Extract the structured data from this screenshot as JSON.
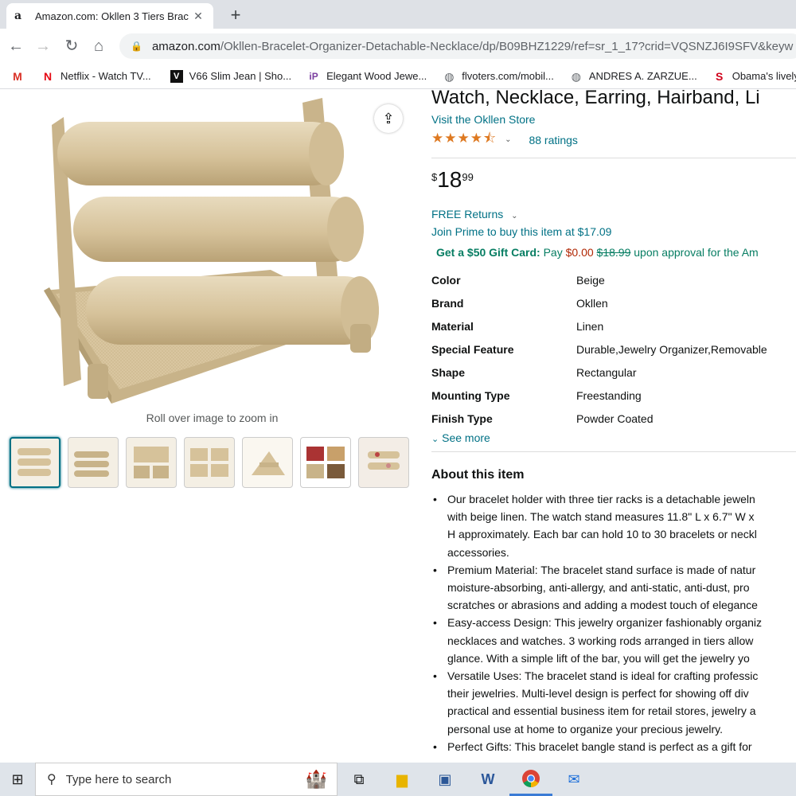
{
  "browser": {
    "tab_favicon": "a",
    "tab_title": "Amazon.com: Okllen 3 Tiers Brac",
    "tab_close": "✕",
    "new_tab": "+",
    "url_host": "amazon.com",
    "url_path": "/Okllen-Bracelet-Organizer-Detachable-Necklace/dp/B09BHZ1229/ref=sr_1_17?crid=VQSNZJ6I9SFV&keyw"
  },
  "bookmarks": [
    {
      "icon": "M",
      "label": ""
    },
    {
      "icon": "N",
      "label": "Netflix - Watch TV..."
    },
    {
      "icon": "V",
      "label": "V66 Slim Jean | Sho..."
    },
    {
      "icon": "iP",
      "label": "Elegant Wood Jewe..."
    },
    {
      "icon": "globe",
      "label": "flvoters.com/mobil..."
    },
    {
      "icon": "globe",
      "label": "ANDRES A. ZARZUE..."
    },
    {
      "icon": "S",
      "label": "Obama's lively l"
    }
  ],
  "gallery": {
    "zoom_hint": "Roll over image to zoom in",
    "share_icon": "share-icon"
  },
  "product": {
    "title": "Watch, Necklace, Earring, Hairband, Li",
    "store": "Visit the Okllen Store",
    "stars": "★★★★⯪",
    "rating_value": 4.5,
    "ratings": "88 ratings",
    "price_symbol": "$",
    "price_whole": "18",
    "price_fraction": "99",
    "returns": "FREE Returns",
    "prime": "Join Prime to buy this item at $17.09",
    "gift_label": "Get a $50 Gift Card:",
    "gift_pay": "Pay",
    "gift_new": "$0.00",
    "gift_old": "$18.99",
    "gift_tail": "upon approval for the Am"
  },
  "specs": [
    {
      "k": "Color",
      "v": "Beige"
    },
    {
      "k": "Brand",
      "v": "Okllen"
    },
    {
      "k": "Material",
      "v": "Linen"
    },
    {
      "k": "Special Feature",
      "v": "Durable,Jewelry Organizer,Removable"
    },
    {
      "k": "Shape",
      "v": "Rectangular"
    },
    {
      "k": "Mounting Type",
      "v": "Freestanding"
    },
    {
      "k": "Finish Type",
      "v": "Powder Coated"
    }
  ],
  "see_more": "See more",
  "about": {
    "heading": "About this item",
    "lines": [
      "Our bracelet holder with three tier racks is a detachable jeweln",
      "with beige linen. The watch stand measures 11.8\" L x 6.7\" W x",
      "H approximately. Each bar can hold 10 to 30 bracelets or neckl",
      "accessories.",
      "Premium Material: The bracelet stand surface is made of natur",
      "moisture-absorbing, anti-allergy, and anti-static, anti-dust, pro",
      "scratches or abrasions and adding a modest touch of elegance",
      "Easy-access Design: This jewelry organizer fashionably organiz",
      "necklaces and watches. 3 working rods arranged in tiers allow",
      "glance. With a simple lift of the bar, you will get the jewelry yo",
      "Versatile Uses: The bracelet stand is ideal for crafting professic",
      "their jewelries. Multi-level design is perfect for showing off div",
      "practical and essential business item for retail stores, jewelry a",
      "personal use at home to organize your precious jewelry.",
      "Perfect Gifts: This bracelet bangle stand is perfect as a gift for"
    ],
    "bullet_starts": [
      0,
      4,
      7,
      10,
      14
    ]
  },
  "taskbar": {
    "search_placeholder": "Type here to search"
  },
  "colors": {
    "link": "#007185",
    "price_red": "#b12704",
    "star": "#de7921",
    "linen": "#d9c6a0"
  }
}
